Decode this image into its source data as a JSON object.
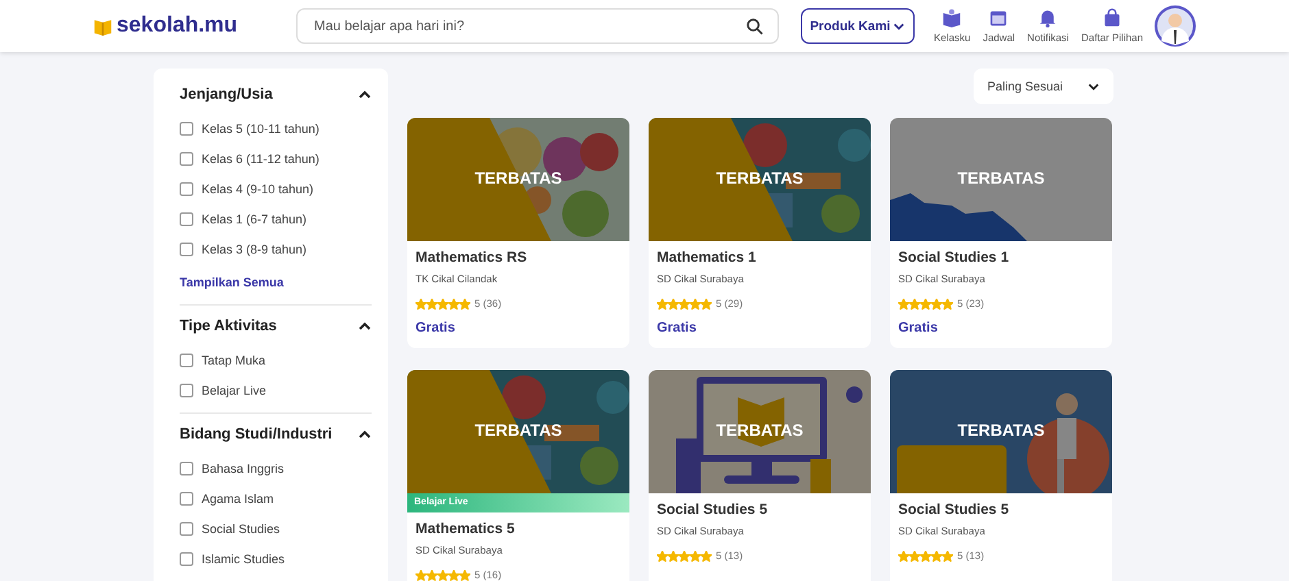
{
  "header": {
    "logo": "sekolah.mu",
    "search": {
      "placeholder": "Mau belajar apa hari ini?"
    },
    "product_button": "Produk Kami",
    "nav": [
      {
        "label": "Kelasku",
        "kind": "book"
      },
      {
        "label": "Jadwal",
        "kind": "calendar"
      },
      {
        "label": "Notifikasi",
        "kind": "bell"
      },
      {
        "label": "Daftar Pilihan",
        "kind": "bag"
      }
    ]
  },
  "filters": [
    {
      "title": "Jenjang/Usia",
      "expanded": true,
      "options": [
        {
          "label": "Kelas 5 (10-11 tahun)",
          "checked": false
        },
        {
          "label": "Kelas 6 (11-12 tahun)",
          "checked": false
        },
        {
          "label": "Kelas 4 (9-10 tahun)",
          "checked": false
        },
        {
          "label": "Kelas 1 (6-7 tahun)",
          "checked": false
        },
        {
          "label": "Kelas 3 (8-9 tahun)",
          "checked": false
        }
      ],
      "show_all": "Tampilkan Semua"
    },
    {
      "title": "Tipe Aktivitas",
      "expanded": true,
      "options": [
        {
          "label": "Tatap Muka",
          "checked": false
        },
        {
          "label": "Belajar Live",
          "checked": false
        }
      ]
    },
    {
      "title": "Bidang Studi/Industri",
      "expanded": true,
      "options": [
        {
          "label": "Bahasa Inggris",
          "checked": false
        },
        {
          "label": "Agama Islam",
          "checked": false
        },
        {
          "label": "Social Studies",
          "checked": false
        },
        {
          "label": "Islamic Studies",
          "checked": false
        }
      ]
    }
  ],
  "sort": {
    "value": "Paling Sesuai"
  },
  "courses": [
    {
      "overlay": "TERBATAS",
      "title": "Mathematics RS",
      "school": "TK Cikal Cilandak",
      "stars": 5,
      "rating": "5 (36)",
      "price": "Gratis"
    },
    {
      "overlay": "TERBATAS",
      "title": "Mathematics 1",
      "school": "SD Cikal Surabaya",
      "stars": 5,
      "rating": "5 (29)",
      "price": "Gratis"
    },
    {
      "overlay": "TERBATAS",
      "title": "Social Studies 1",
      "school": "SD Cikal Surabaya",
      "stars": 5,
      "rating": "5 (23)",
      "price": "Gratis"
    },
    {
      "overlay": "TERBATAS",
      "badge": "Belajar Live",
      "title": "Mathematics 5",
      "school": "SD Cikal Surabaya",
      "stars": 5,
      "rating": "5 (16)"
    },
    {
      "overlay": "TERBATAS",
      "title": "Social Studies 5",
      "school": "SD Cikal Surabaya",
      "stars": 5,
      "rating": "5 (13)"
    },
    {
      "overlay": "TERBATAS",
      "title": "Social Studies 5",
      "school": "SD Cikal Surabaya",
      "stars": 5,
      "rating": "5 (13)"
    }
  ]
}
